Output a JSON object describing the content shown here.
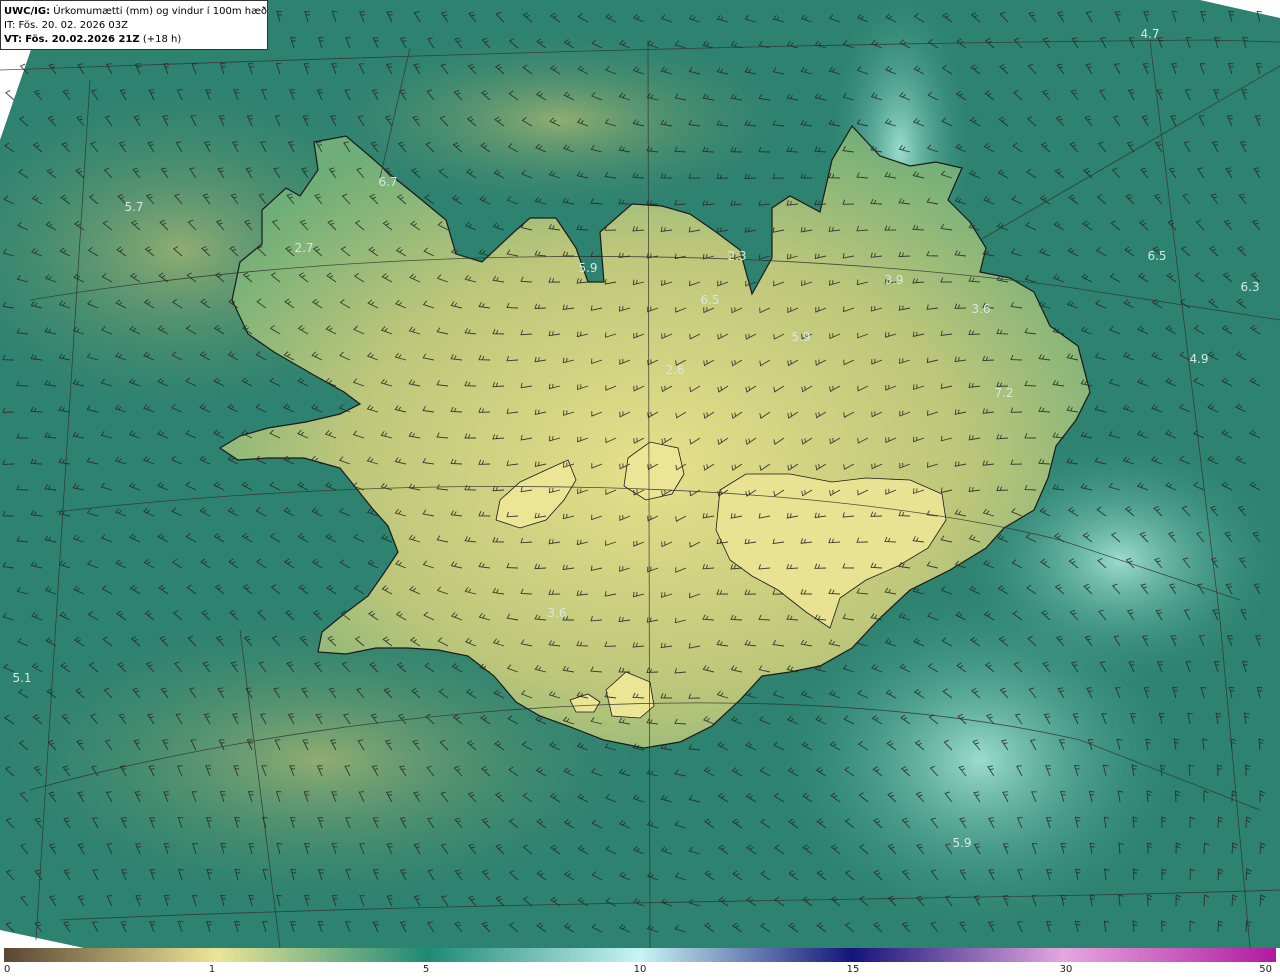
{
  "header": {
    "product": "UWC/IG:",
    "description": "Úrkomumætti (mm) og vindur í 100m hæð",
    "init_label": "IT:",
    "init_time": "Fös. 20. 02. 2026 03Z",
    "valid_label": "VT:",
    "valid_time": "Fös. 20.02.2026 21Z",
    "lead": "(+18 h)"
  },
  "map_values": [
    "4.7",
    "6.7",
    "5.7",
    "2.7",
    "5.9",
    "2.3",
    "6.5",
    "3.9",
    "6.5",
    "6.3",
    "3.6",
    "5.9",
    "2.6",
    "4.9",
    "7.2",
    "3.6",
    "5.1",
    "5.9"
  ],
  "colorbar": {
    "ticks": [
      "0",
      "1",
      "5",
      "10",
      "15",
      "30",
      "50"
    ],
    "colors": {
      "c0": "#5a4633",
      "c1": "#ece596",
      "c5": "#1d8a75",
      "c10": "#c8f4f4",
      "c15": "#14147a",
      "c30": "#e6a6e0",
      "c50": "#b01aa0"
    }
  },
  "colors": {
    "sea_dark": "#1f6e5e",
    "sea_mid": "#2e8874",
    "sea_light": "#8fd8c8",
    "land_low": "#b8c47a",
    "land_high": "#e6e08a",
    "coast": "#1a1a1a",
    "grid": "#333333",
    "barb": "#2a2a2a",
    "label": "#d8e8e0"
  }
}
